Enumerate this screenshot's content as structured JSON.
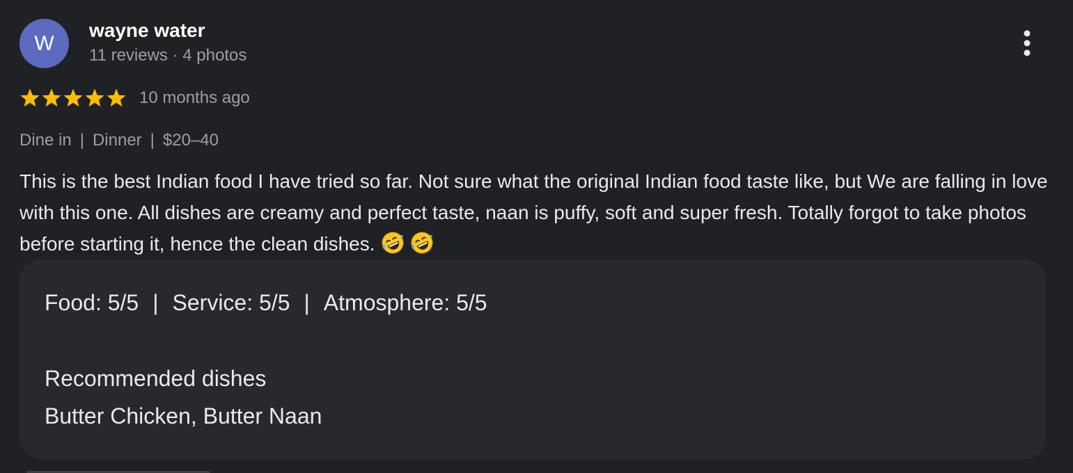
{
  "author": {
    "initial": "W",
    "name": "wayne water",
    "meta": "11 reviews · 4 photos"
  },
  "rating": {
    "stars": 5,
    "max_stars": 5,
    "star_color": "#fbbc04",
    "time_ago": "10 months ago"
  },
  "tags": [
    "Dine in",
    "Dinner",
    "$20–40"
  ],
  "tag_separator": "|",
  "review_text": "This is the best Indian food I have tried so far. Not sure what the original Indian food taste like, but We are falling in love with this one. All dishes are creamy and perfect taste, naan is puffy, soft and super fresh. Totally forgot to take photos before starting it, hence the clean dishes.",
  "emojis": [
    "rolling-on-floor-laughing-emoji",
    "rolling-on-floor-laughing-emoji"
  ],
  "details": {
    "ratings": [
      "Food: 5/5",
      "Service: 5/5",
      "Atmosphere: 5/5"
    ],
    "separator": "|",
    "recommended_title": "Recommended dishes",
    "recommended_dishes": "Butter Chicken, Butter Naan"
  },
  "colors": {
    "background": "#202124",
    "card": "#28292c",
    "avatar": "#5c6bc0",
    "secondary_text": "#9aa0a6"
  },
  "icons": {
    "more": "more-vert-icon"
  }
}
